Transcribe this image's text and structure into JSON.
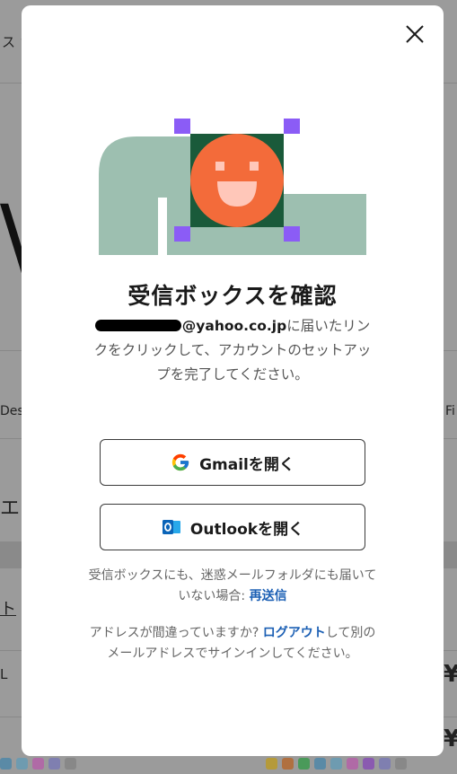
{
  "background": {
    "left_fragment_1": "ス ∨",
    "left_fragment_2": "Des",
    "right_fragment_2": "Fi",
    "left_fragment_3": "エ",
    "left_fragment_4": "ト",
    "left_fragment_5": "L",
    "right_price_1": "¥",
    "right_price_2": "¥"
  },
  "modal": {
    "close_icon": "close-icon",
    "title": "受信ボックスを確認",
    "email_visible_part": "@yahoo.co.jp",
    "description_rest": "に届いたリンクをクリックして、アカウントのセットアップを完了してください。",
    "gmail_button_label": "Gmailを開く",
    "outlook_button_label": "Outlookを開く",
    "resend_text": "受信ボックスにも、迷惑メールフォルダにも届いていない場合: ",
    "resend_link": "再送信",
    "wrong_address_text": "アドレスが間違っていますか? ",
    "logout_link": "ログアウト",
    "wrong_address_rest": "して別のメールアドレスでサインインしてください。"
  },
  "colors": {
    "illustration_sage": "#9dbfb0",
    "illustration_dark_green": "#1a5a3a",
    "illustration_orange": "#f36b3a",
    "illustration_purple": "#8b5cf6",
    "link_blue": "#1b5fb4",
    "outlook_blue": "#0a64b8"
  }
}
